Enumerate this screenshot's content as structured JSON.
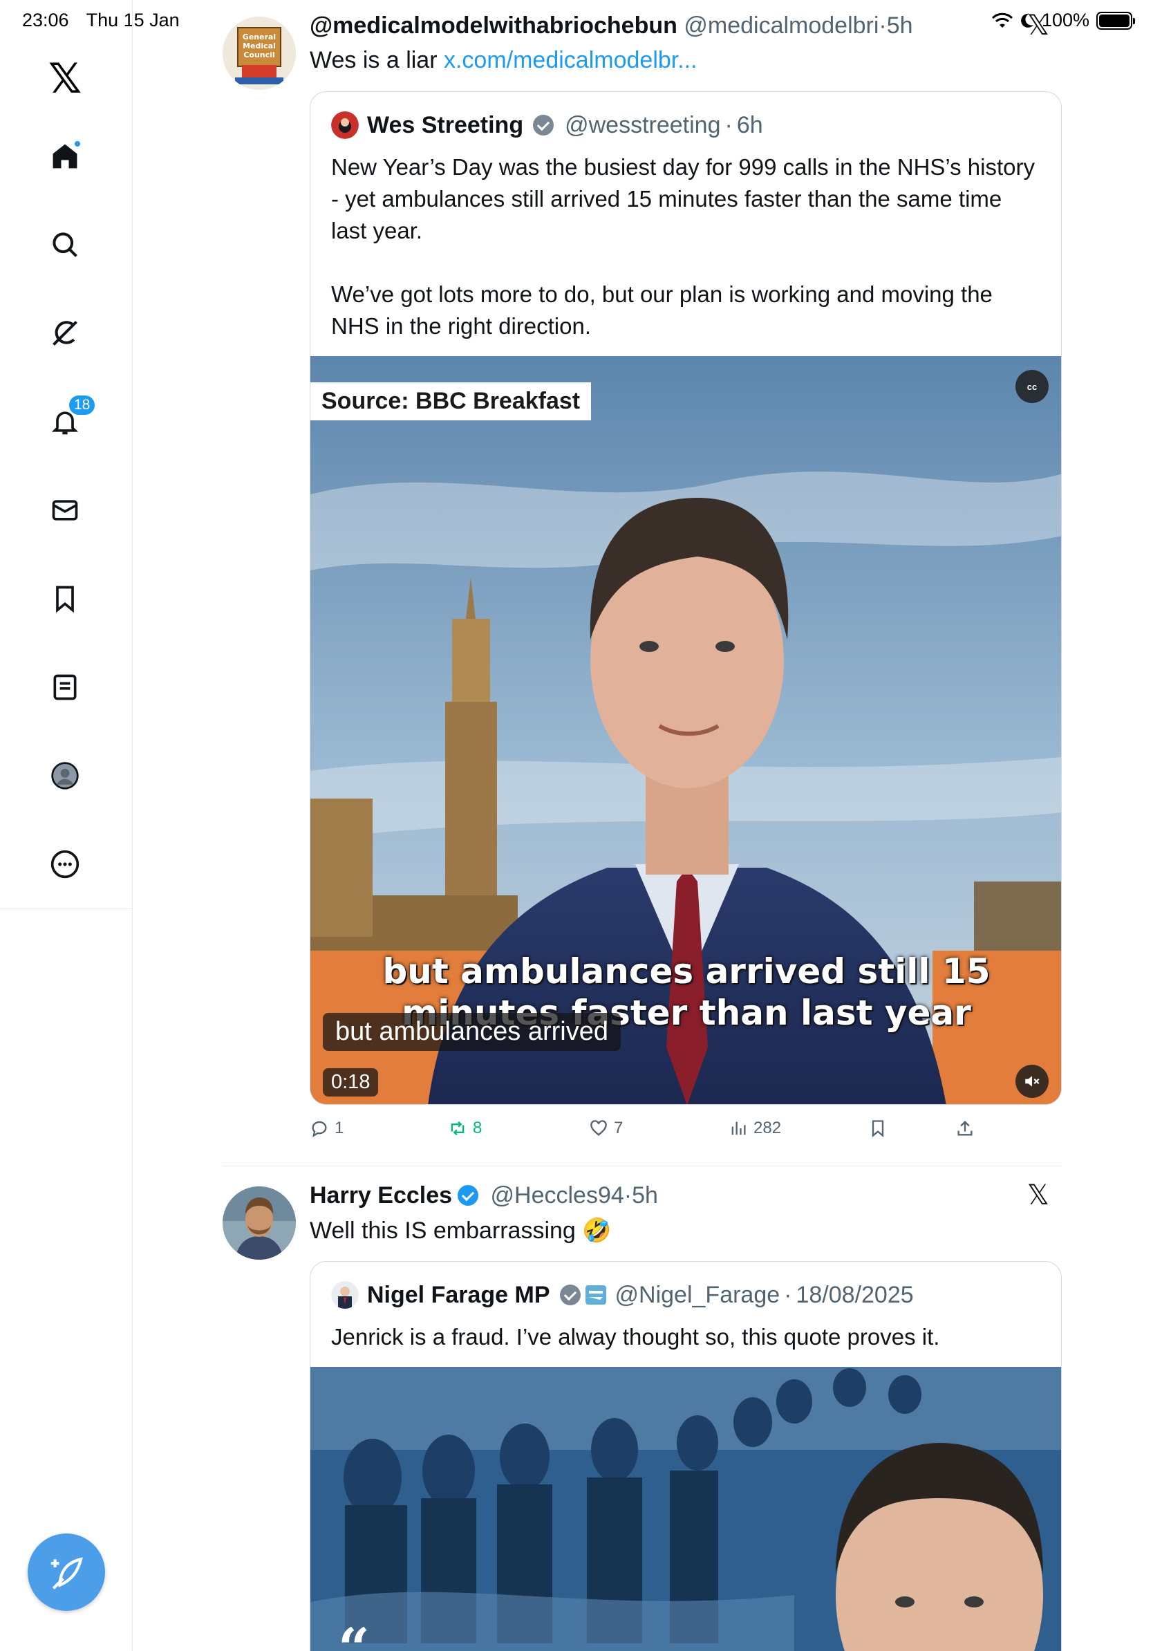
{
  "status_bar": {
    "time": "23:06",
    "date": "Thu 15 Jan",
    "battery": "100%"
  },
  "sidebar": {
    "notifications_badge": "18",
    "items": [
      {
        "name": "x-logo",
        "icon": "x-logo-icon"
      },
      {
        "name": "home",
        "icon": "home-icon"
      },
      {
        "name": "explore",
        "icon": "search-icon"
      },
      {
        "name": "grok",
        "icon": "grok-icon"
      },
      {
        "name": "notifications",
        "icon": "bell-icon"
      },
      {
        "name": "messages",
        "icon": "mail-icon"
      },
      {
        "name": "bookmarks",
        "icon": "bookmark-icon"
      },
      {
        "name": "lists",
        "icon": "list-icon"
      },
      {
        "name": "profile",
        "icon": "profile-icon"
      },
      {
        "name": "more",
        "icon": "more-icon"
      }
    ],
    "compose_icon": "compose-icon"
  },
  "tweets": [
    {
      "name": "@medicalmodelwithabriochebun",
      "handle": "@medicalmodelbri",
      "time": "5h",
      "text": "Wes is a liar ",
      "link": "x.com/medicalmodelbr...",
      "avatar_text": "General Medical Council",
      "quote": {
        "name": "Wes Streeting",
        "handle": "@wesstreeting",
        "time": "6h",
        "paragraphs": [
          "New Year’s Day was the busiest day for 999 calls in the NHS’s history - yet ambulances still arrived 15 minutes faster than the same time last year.",
          "We’ve got lots more to do, but our plan is working and moving the NHS in the right direction."
        ],
        "video": {
          "source_tag": "Source: BBC Breakfast",
          "cc_label": "cc",
          "burned_caption_line1": "but ambulances arrived still 15",
          "burned_caption_line2": "minutes faster than last year",
          "live_caption": "but ambulances arrived",
          "duration": "0:18"
        }
      },
      "actions": {
        "replies": "1",
        "reposts": "8",
        "likes": "7",
        "views": "282"
      }
    },
    {
      "name": "Harry Eccles",
      "handle": "@Heccles94",
      "time": "5h",
      "text": "Well this IS embarrassing",
      "emoji": "🤣",
      "quote": {
        "name": "Nigel Farage MP",
        "handle": "@Nigel_Farage",
        "time": "18/08/2025",
        "text": "Jenrick is a fraud. I’ve alway thought so, this quote proves it.",
        "quote_mark": "“"
      }
    }
  ],
  "colors": {
    "accent": "#1d9bf0",
    "repost": "#00ba7c",
    "text": "#0f1419",
    "muted": "#536471"
  }
}
